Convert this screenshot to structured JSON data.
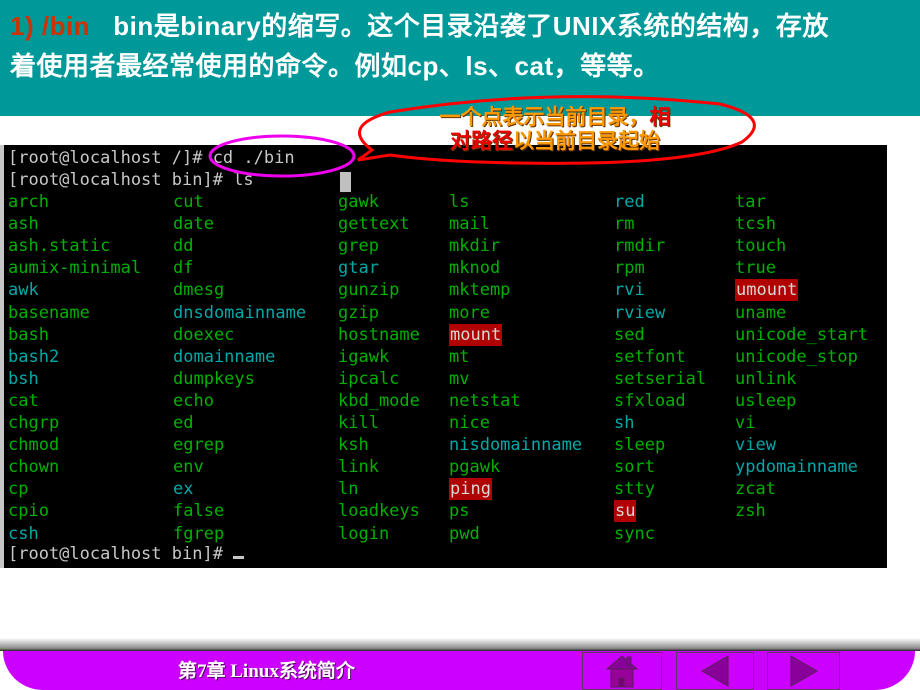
{
  "header": {
    "prefix": "1) /bin",
    "line1_rest": "bin是binary的缩写。这个目录沿袭了UNIX系统的结构，存放",
    "line2": "着使用者最经常使用的命令。例如cp、ls、cat，等等。"
  },
  "callout": {
    "line1_main": "一个点表示当前目录，",
    "line1_red": "相",
    "line2_red": "对路径",
    "line2_main": "以当前目录起始"
  },
  "terminal": {
    "prompt_line_1": "[root@localhost /]# cd ./bin",
    "prompt_line_2": "[root@localhost bin]# ls",
    "prompt_final": "[root@localhost bin]# ",
    "colors": {
      "executable": "#00b000",
      "symlink": "#00a8a8",
      "setuid_bg": "#b00000"
    },
    "columns": [
      [
        {
          "name": "arch",
          "type": "exec"
        },
        {
          "name": "ash",
          "type": "exec"
        },
        {
          "name": "ash.static",
          "type": "exec"
        },
        {
          "name": "aumix-minimal",
          "type": "exec"
        },
        {
          "name": "awk",
          "type": "link"
        },
        {
          "name": "basename",
          "type": "exec"
        },
        {
          "name": "bash",
          "type": "exec"
        },
        {
          "name": "bash2",
          "type": "link"
        },
        {
          "name": "bsh",
          "type": "link"
        },
        {
          "name": "cat",
          "type": "exec"
        },
        {
          "name": "chgrp",
          "type": "exec"
        },
        {
          "name": "chmod",
          "type": "exec"
        },
        {
          "name": "chown",
          "type": "exec"
        },
        {
          "name": "cp",
          "type": "exec"
        },
        {
          "name": "cpio",
          "type": "exec"
        },
        {
          "name": "csh",
          "type": "link"
        }
      ],
      [
        {
          "name": "cut",
          "type": "exec"
        },
        {
          "name": "date",
          "type": "exec"
        },
        {
          "name": "dd",
          "type": "exec"
        },
        {
          "name": "df",
          "type": "exec"
        },
        {
          "name": "dmesg",
          "type": "exec"
        },
        {
          "name": "dnsdomainname",
          "type": "link"
        },
        {
          "name": "doexec",
          "type": "exec"
        },
        {
          "name": "domainname",
          "type": "link"
        },
        {
          "name": "dumpkeys",
          "type": "exec"
        },
        {
          "name": "echo",
          "type": "exec"
        },
        {
          "name": "ed",
          "type": "exec"
        },
        {
          "name": "egrep",
          "type": "exec"
        },
        {
          "name": "env",
          "type": "exec"
        },
        {
          "name": "ex",
          "type": "link"
        },
        {
          "name": "false",
          "type": "exec"
        },
        {
          "name": "fgrep",
          "type": "exec"
        }
      ],
      [
        {
          "name": "gawk",
          "type": "exec"
        },
        {
          "name": "gettext",
          "type": "exec"
        },
        {
          "name": "grep",
          "type": "exec"
        },
        {
          "name": "gtar",
          "type": "link"
        },
        {
          "name": "gunzip",
          "type": "exec"
        },
        {
          "name": "gzip",
          "type": "exec"
        },
        {
          "name": "hostname",
          "type": "exec"
        },
        {
          "name": "igawk",
          "type": "exec"
        },
        {
          "name": "ipcalc",
          "type": "exec"
        },
        {
          "name": "kbd_mode",
          "type": "exec"
        },
        {
          "name": "kill",
          "type": "exec"
        },
        {
          "name": "ksh",
          "type": "exec"
        },
        {
          "name": "link",
          "type": "exec"
        },
        {
          "name": "ln",
          "type": "exec"
        },
        {
          "name": "loadkeys",
          "type": "exec"
        },
        {
          "name": "login",
          "type": "exec"
        }
      ],
      [
        {
          "name": "ls",
          "type": "exec"
        },
        {
          "name": "mail",
          "type": "exec"
        },
        {
          "name": "mkdir",
          "type": "exec"
        },
        {
          "name": "mknod",
          "type": "exec"
        },
        {
          "name": "mktemp",
          "type": "exec"
        },
        {
          "name": "more",
          "type": "exec"
        },
        {
          "name": "mount",
          "type": "suid"
        },
        {
          "name": "mt",
          "type": "exec"
        },
        {
          "name": "mv",
          "type": "exec"
        },
        {
          "name": "netstat",
          "type": "exec"
        },
        {
          "name": "nice",
          "type": "exec"
        },
        {
          "name": "nisdomainname",
          "type": "link"
        },
        {
          "name": "pgawk",
          "type": "exec"
        },
        {
          "name": "ping",
          "type": "suid"
        },
        {
          "name": "ps",
          "type": "exec"
        },
        {
          "name": "pwd",
          "type": "exec"
        }
      ],
      [
        {
          "name": "red",
          "type": "link"
        },
        {
          "name": "rm",
          "type": "exec"
        },
        {
          "name": "rmdir",
          "type": "exec"
        },
        {
          "name": "rpm",
          "type": "exec"
        },
        {
          "name": "rvi",
          "type": "link"
        },
        {
          "name": "rview",
          "type": "link"
        },
        {
          "name": "sed",
          "type": "exec"
        },
        {
          "name": "setfont",
          "type": "exec"
        },
        {
          "name": "setserial",
          "type": "exec"
        },
        {
          "name": "sfxload",
          "type": "exec"
        },
        {
          "name": "sh",
          "type": "link"
        },
        {
          "name": "sleep",
          "type": "exec"
        },
        {
          "name": "sort",
          "type": "exec"
        },
        {
          "name": "stty",
          "type": "exec"
        },
        {
          "name": "su",
          "type": "suid"
        },
        {
          "name": "sync",
          "type": "exec"
        }
      ],
      [
        {
          "name": "tar",
          "type": "exec"
        },
        {
          "name": "tcsh",
          "type": "exec"
        },
        {
          "name": "touch",
          "type": "exec"
        },
        {
          "name": "true",
          "type": "exec"
        },
        {
          "name": "umount",
          "type": "suid"
        },
        {
          "name": "uname",
          "type": "exec"
        },
        {
          "name": "unicode_start",
          "type": "exec"
        },
        {
          "name": "unicode_stop",
          "type": "exec"
        },
        {
          "name": "unlink",
          "type": "exec"
        },
        {
          "name": "usleep",
          "type": "exec"
        },
        {
          "name": "vi",
          "type": "exec"
        },
        {
          "name": "view",
          "type": "link"
        },
        {
          "name": "ypdomainname",
          "type": "link"
        },
        {
          "name": "zcat",
          "type": "exec"
        },
        {
          "name": "zsh",
          "type": "exec"
        }
      ]
    ]
  },
  "footer": {
    "title": "第7章 Linux系统简介",
    "buttons": [
      {
        "name": "home",
        "icon": "home-icon"
      },
      {
        "name": "previous",
        "icon": "triangle-left-icon"
      },
      {
        "name": "next",
        "icon": "triangle-right-icon"
      }
    ]
  }
}
